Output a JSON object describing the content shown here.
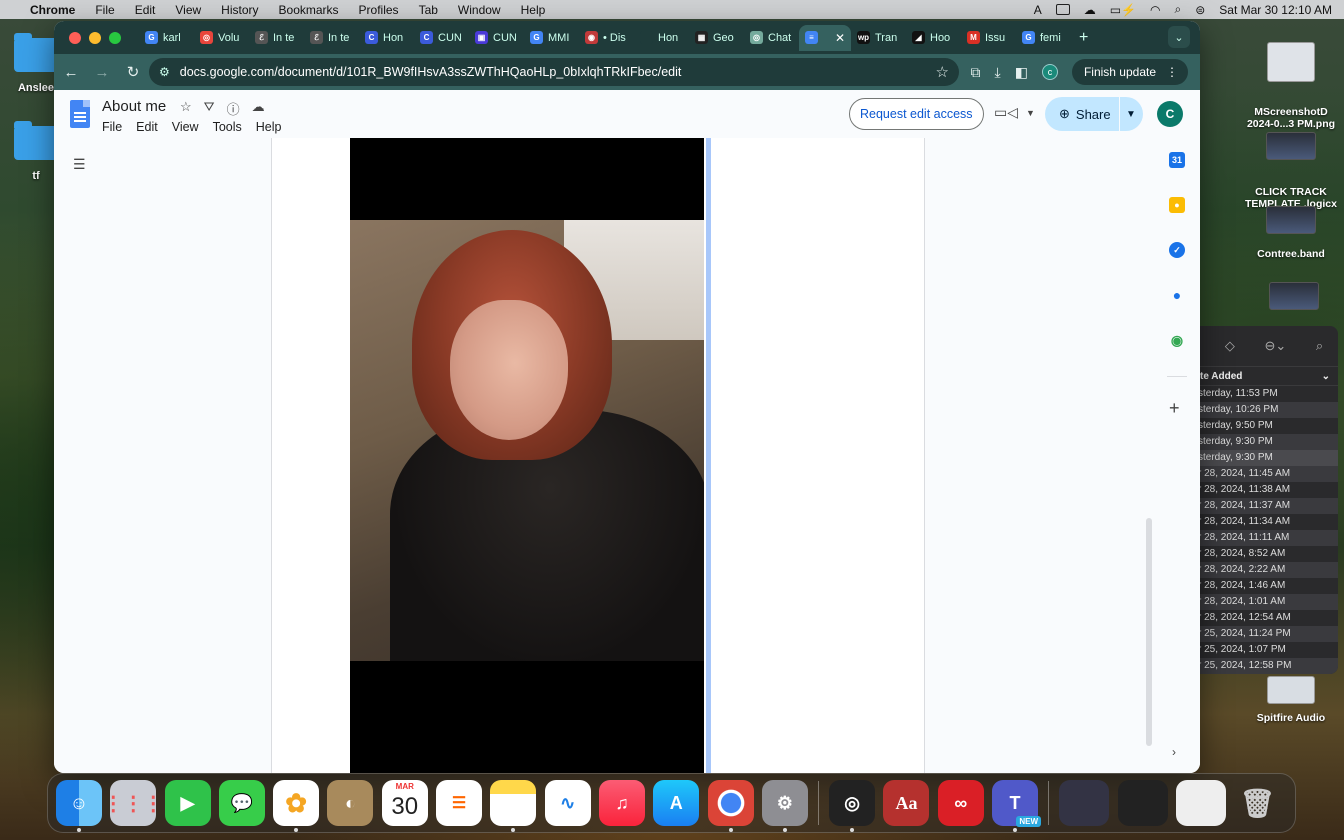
{
  "menubar": {
    "app_name": "Chrome",
    "items": [
      "File",
      "Edit",
      "View",
      "History",
      "Bookmarks",
      "Profiles",
      "Tab",
      "Window",
      "Help"
    ],
    "datetime": "Sat Mar 30  12:10 AM"
  },
  "desktop": {
    "icons": [
      {
        "label": "Anslee"
      },
      {
        "label": "tf"
      },
      {
        "label": "MScreenshotD\n2024-0...3 PM.png"
      },
      {
        "label": "CLICK TRACK\nTEMPLATE .logicx"
      },
      {
        "label": "Contree.band"
      },
      {
        "label": "Spitfire Audio"
      }
    ]
  },
  "photos_panel": {
    "sort_header": "te Added",
    "rows": [
      "sterday, 11:53 PM",
      "sterday, 10:26 PM",
      "sterday, 9:50 PM",
      "sterday, 9:30 PM",
      "sterday, 9:30 PM",
      "r 28, 2024, 11:45 AM",
      "r 28, 2024, 11:38 AM",
      "r 28, 2024, 11:37 AM",
      "r 28, 2024, 11:34 AM",
      "r 28, 2024, 11:11 AM",
      "r 28, 2024, 8:52 AM",
      "r 28, 2024, 2:22 AM",
      "r 28, 2024, 1:46 AM",
      "r 28, 2024, 1:01 AM",
      "r 28, 2024, 12:54 AM",
      "r 25, 2024, 11:24 PM",
      "r 25, 2024, 1:07 PM",
      "r 25, 2024, 12:58 PM"
    ]
  },
  "browser": {
    "tabs": [
      {
        "label": "karl",
        "color": "#4285f4",
        "icon": "G"
      },
      {
        "label": "Volu",
        "color": "#e8453c",
        "icon": "◎"
      },
      {
        "label": "In te",
        "color": "#555555",
        "icon": "ℰ"
      },
      {
        "label": "In te",
        "color": "#555555",
        "icon": "ℰ"
      },
      {
        "label": "Hon",
        "color": "#3b5bdb",
        "icon": "C"
      },
      {
        "label": "CUN",
        "color": "#3b5bdb",
        "icon": "C"
      },
      {
        "label": "CUN",
        "color": "#4a3ad8",
        "icon": "▣"
      },
      {
        "label": "MMI",
        "color": "#4285f4",
        "icon": "G"
      },
      {
        "label": "• Dis",
        "color": "#c23a3a",
        "icon": "◉"
      },
      {
        "label": "Hon",
        "color": "#1f3b3a",
        "icon": ""
      },
      {
        "label": "Geo",
        "color": "#222222",
        "icon": "▦"
      },
      {
        "label": "Chat",
        "color": "#74aa9c",
        "icon": "◎"
      },
      {
        "label": "",
        "color": "#4285f4",
        "icon": "≡",
        "active": true
      },
      {
        "label": "Tran",
        "color": "#111111",
        "icon": "wp"
      },
      {
        "label": "Hoo",
        "color": "#111111",
        "icon": "◢"
      },
      {
        "label": "Issu",
        "color": "#d93025",
        "icon": "M"
      },
      {
        "label": "femi",
        "color": "#4285f4",
        "icon": "G"
      }
    ],
    "url": "docs.google.com/document/d/101R_BW9fIHsvA3ssZWThHQaoHLp_0bIxlqhTRkIFbec/edit",
    "profile_initial": "c",
    "finish_update_label": "Finish update"
  },
  "docs": {
    "title": "About me",
    "menu": [
      "File",
      "Edit",
      "View",
      "Tools",
      "Help"
    ],
    "request_edit_label": "Request edit access",
    "share_label": "Share",
    "avatar_initial": "C"
  },
  "dock": {
    "calendar_month": "MAR",
    "calendar_day": "30",
    "teams_badge": "NEW"
  }
}
